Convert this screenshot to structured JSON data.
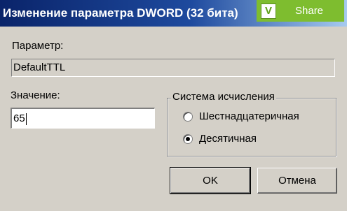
{
  "window": {
    "title": "Изменение параметра DWORD (32 бита)"
  },
  "share": {
    "logo": "V",
    "label": "Share"
  },
  "parameter": {
    "label": "Параметр:",
    "value": "DefaultTTL"
  },
  "value": {
    "label": "Значение:",
    "input_value": "65"
  },
  "radix": {
    "legend": "Система исчисления",
    "options": [
      {
        "label": "Шестнадцатеричная",
        "selected": false
      },
      {
        "label": "Десятичная",
        "selected": true
      }
    ]
  },
  "buttons": {
    "ok": "OK",
    "cancel": "Отмена"
  }
}
